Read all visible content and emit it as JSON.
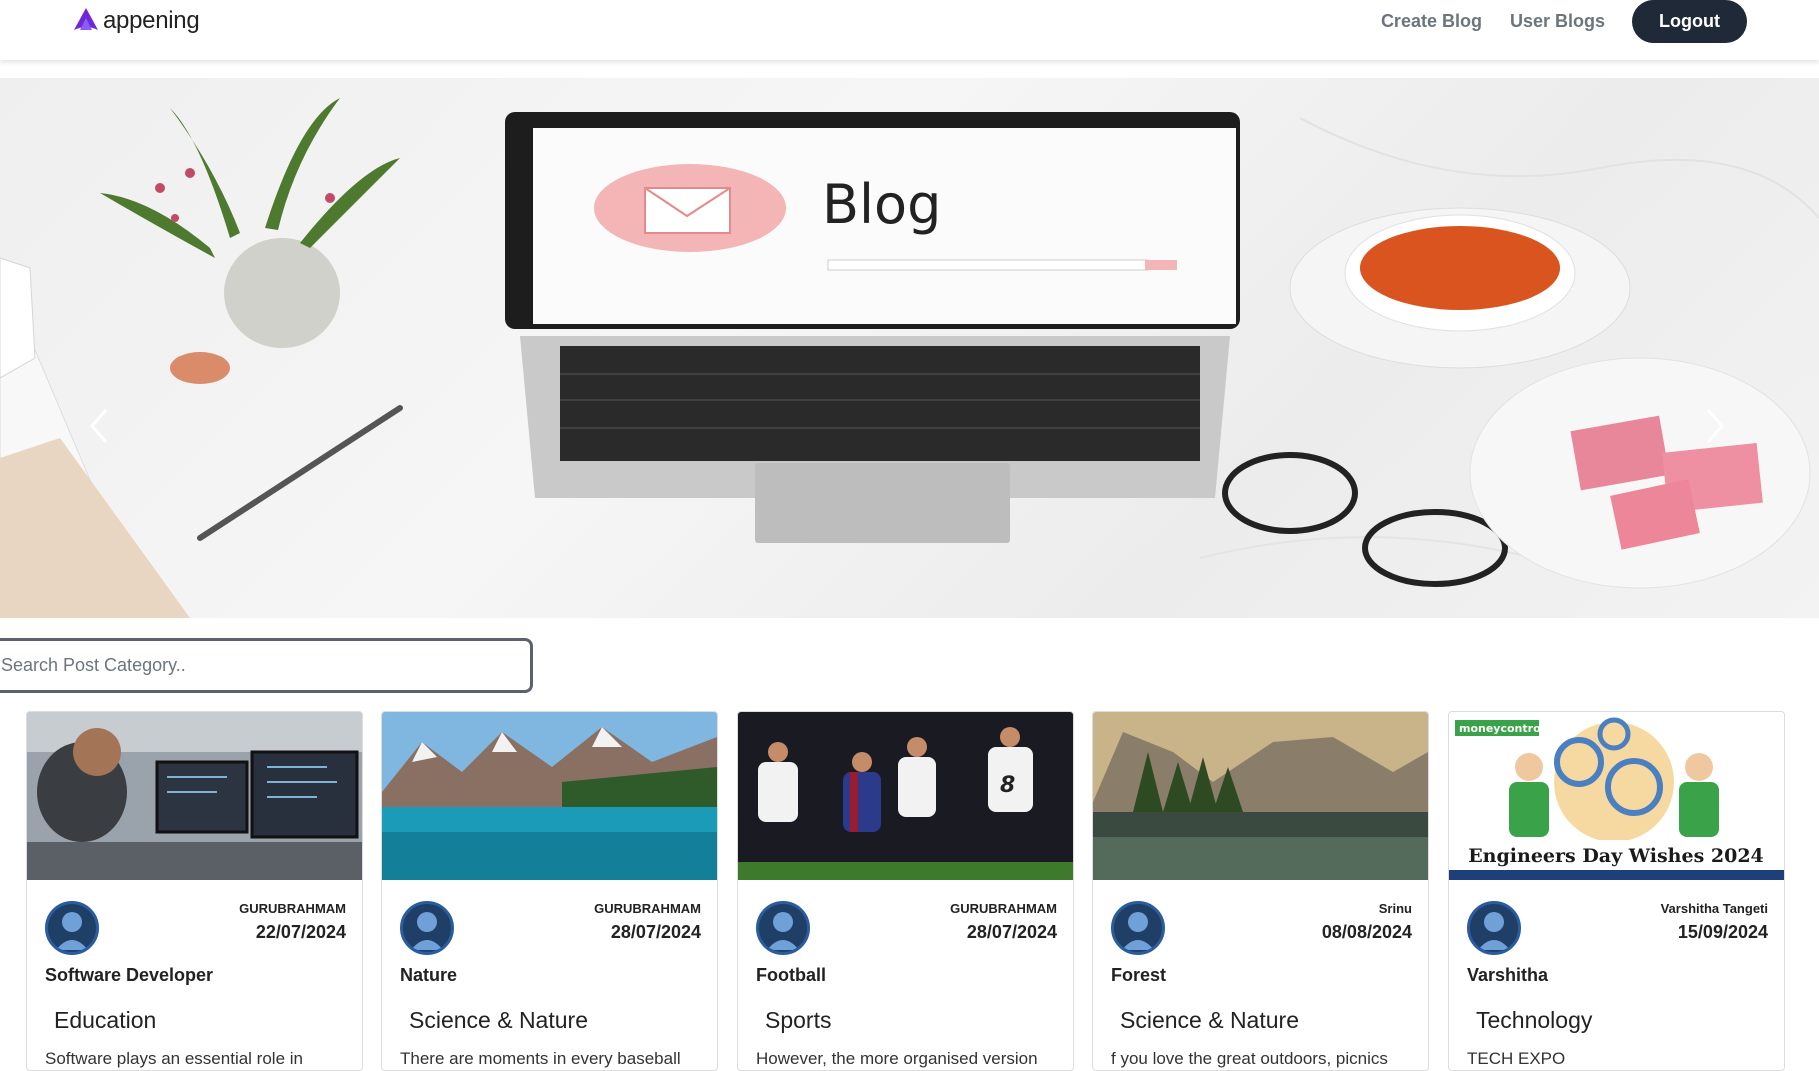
{
  "brand": {
    "name": "appening",
    "logo_icon": "purple-a-logo-icon"
  },
  "nav": {
    "create_blog": "Create Blog",
    "user_blogs": "User Blogs",
    "logout": "Logout"
  },
  "hero": {
    "screen_text": "Blog",
    "prev_icon": "chevron-left-icon",
    "next_icon": "chevron-right-icon"
  },
  "search": {
    "placeholder": "Search Post Category.."
  },
  "colors": {
    "logout_bg": "#1f2937",
    "nav_link": "#6c757d",
    "brand_purple": "#6d28d9"
  },
  "posts": [
    {
      "author": "GURUBRAHMAM",
      "date": "22/07/2024",
      "title": "Software Developer",
      "category": "Education",
      "excerpt": "Software plays an essential role in"
    },
    {
      "author": "GURUBRAHMAM",
      "date": "28/07/2024",
      "title": "Nature",
      "category": "Science & Nature",
      "excerpt": "There are moments in every baseball"
    },
    {
      "author": "GURUBRAHMAM",
      "date": "28/07/2024",
      "title": "Football",
      "category": "Sports",
      "excerpt": "However, the more organised version"
    },
    {
      "author": "Srinu",
      "date": "08/08/2024",
      "title": "Forest",
      "category": "Science & Nature",
      "excerpt": "f you love the great outdoors, picnics"
    },
    {
      "author": "Varshitha Tangeti",
      "date": "15/09/2024",
      "title": "Varshitha",
      "category": "Technology",
      "excerpt": "TECH EXPO",
      "image_caption": "Engineers Day Wishes 2024",
      "image_badge": "moneycontrol"
    }
  ]
}
